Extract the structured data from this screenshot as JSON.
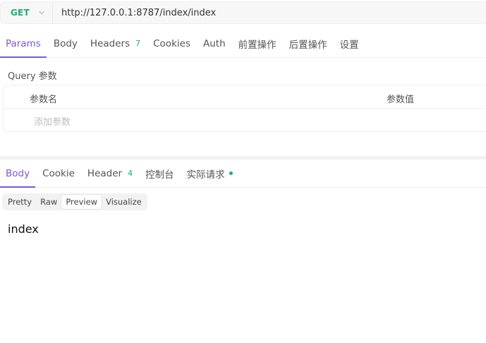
{
  "request": {
    "method": "GET",
    "url": "http://127.0.0.1:8787/index/index",
    "tabs": [
      {
        "label": "Params"
      },
      {
        "label": "Body"
      },
      {
        "label": "Headers",
        "count": "7"
      },
      {
        "label": "Cookies"
      },
      {
        "label": "Auth"
      },
      {
        "label": "前置操作"
      },
      {
        "label": "后置操作"
      },
      {
        "label": "设置"
      }
    ],
    "active_tab": "Params"
  },
  "query": {
    "section_label": "Query 参数",
    "columns": {
      "name": "参数名",
      "value": "参数值"
    },
    "add_placeholder": "添加参数"
  },
  "response": {
    "tabs": [
      {
        "label": "Body"
      },
      {
        "label": "Cookie"
      },
      {
        "label": "Header",
        "count": "4"
      },
      {
        "label": "控制台"
      },
      {
        "label": "实际请求"
      }
    ],
    "active_tab": "Body",
    "view_modes": [
      "Pretty",
      "Raw",
      "Preview",
      "Visualize"
    ],
    "active_view": "Preview",
    "preview_text": "index"
  },
  "colors": {
    "accent": "#7a5ad6",
    "method_get": "#1aae6f",
    "count_badge": "#1aae6f",
    "status_dot": "#1aae6f"
  },
  "icons": {
    "method_dropdown": "chevron-down-icon",
    "actual_request_status": "status-dot-icon"
  }
}
